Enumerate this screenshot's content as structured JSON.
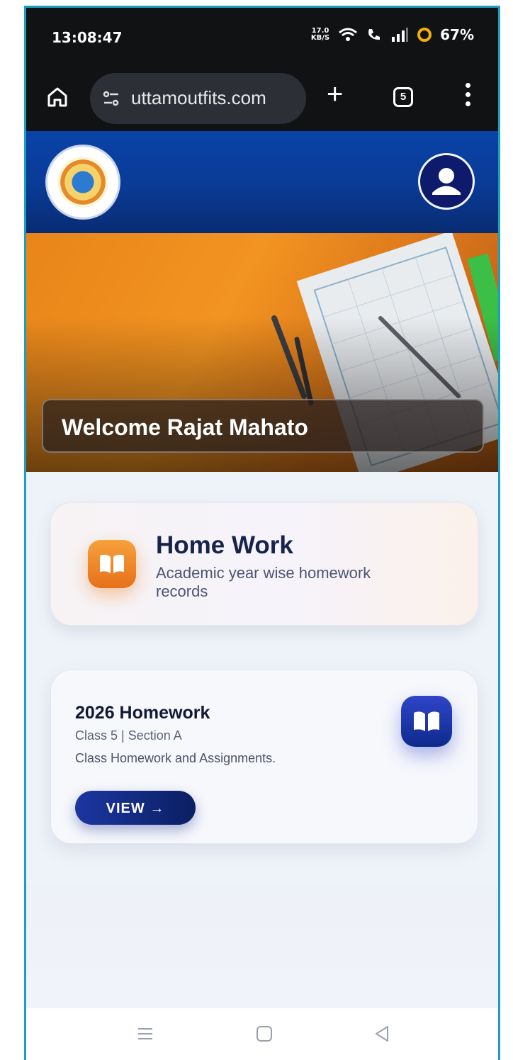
{
  "status_bar": {
    "time": "13:08:47",
    "net_speed_value": "17.0",
    "net_speed_unit": "KB/S",
    "battery": "67%",
    "icons": [
      "wifi-icon",
      "wifi-calling-icon",
      "signal-icon",
      "battery-icon"
    ]
  },
  "browser": {
    "url": "uttamoutfits.com",
    "tab_count": "5",
    "icons": [
      "home-icon",
      "site-settings-icon",
      "new-tab-icon",
      "tabs-icon",
      "more-vert-icon"
    ]
  },
  "hero": {
    "welcome_text": "Welcome Rajat Mahato"
  },
  "homework_card": {
    "title": "Home Work",
    "subtitle": "Academic year wise homework records",
    "icon": "book-icon",
    "accent": "#f08a24"
  },
  "homework_item": {
    "title": "2026 Homework",
    "meta": "Class 5  |  Section A",
    "description": "Class Homework and Assignments.",
    "button_label": "VIEW →",
    "icon": "book-icon",
    "accent": "#1c36a1"
  },
  "colors": {
    "app_bar": "#0a43a8",
    "frame_border": "#1aa0bf"
  },
  "nav_bar": {
    "icons": [
      "recent-apps-icon",
      "home-button-icon",
      "back-icon"
    ]
  }
}
